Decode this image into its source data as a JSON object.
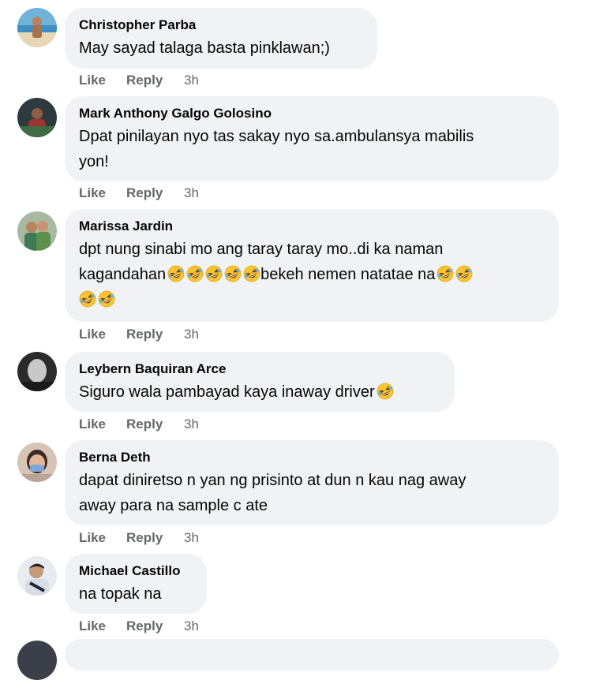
{
  "comments": [
    {
      "author": "Christopher Parba",
      "text": "May sayad talaga basta pinklawan;)",
      "actions": {
        "like": "Like",
        "reply": "Reply",
        "time": "3h"
      }
    },
    {
      "author": "Mark Anthony Galgo Golosino",
      "line1": "Dpat pinilayan nyo tas sakay nyo sa.ambulansya mabilis",
      "line2": "yon!",
      "actions": {
        "like": "Like",
        "reply": "Reply",
        "time": "3h"
      }
    },
    {
      "author": "Marissa Jardin",
      "line1": "dpt nung sinabi mo ang taray taray mo..di ka naman",
      "line2_a": "kagandahan",
      "line2_b": "bekeh nemen natatae na",
      "emoji": "rolling-on-floor-laughing",
      "actions": {
        "like": "Like",
        "reply": "Reply",
        "time": "3h"
      }
    },
    {
      "author": "Leybern Baquiran Arce",
      "text": "Siguro wala pambayad kaya inaway driver",
      "emoji": "rolling-on-floor-laughing",
      "actions": {
        "like": "Like",
        "reply": "Reply",
        "time": "3h"
      }
    },
    {
      "author": "Berna Deth",
      "line1": "dapat diniretso n yan ng prisinto at dun n kau nag away",
      "line2": "away para na sample c ate",
      "actions": {
        "like": "Like",
        "reply": "Reply",
        "time": "3h"
      }
    },
    {
      "author": "Michael Castillo",
      "text": "na topak na",
      "actions": {
        "like": "Like",
        "reply": "Reply",
        "time": "3h"
      }
    }
  ],
  "colors": {
    "bubble": "#f0f2f5",
    "meta": "#65676b",
    "text": "#050505"
  }
}
